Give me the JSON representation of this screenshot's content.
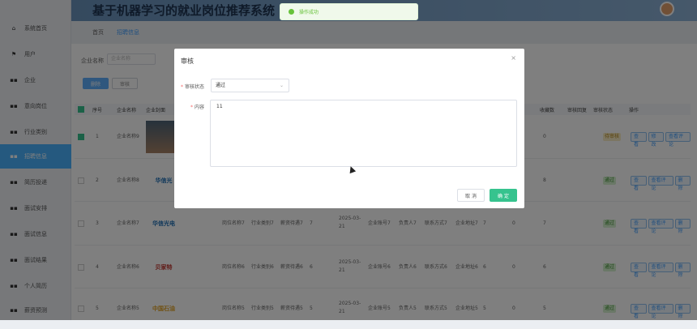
{
  "header": {
    "title": "基于机器学习的就业岗位推荐系统"
  },
  "sidebar": {
    "items": [
      {
        "label": "系统首页",
        "icon": "home-icon"
      },
      {
        "label": "用户",
        "icon": "flag-icon"
      },
      {
        "label": "企业",
        "icon": "grid-icon"
      },
      {
        "label": "意向岗位",
        "icon": "grid-icon"
      },
      {
        "label": "行业类别",
        "icon": "grid-icon"
      },
      {
        "label": "招聘信息",
        "icon": "grid-icon",
        "active": true
      },
      {
        "label": "简历投递",
        "icon": "grid-icon"
      },
      {
        "label": "面试安排",
        "icon": "grid-icon"
      },
      {
        "label": "面试信息",
        "icon": "grid-icon"
      },
      {
        "label": "面试结果",
        "icon": "grid-icon"
      },
      {
        "label": "个人简历",
        "icon": "grid-icon"
      },
      {
        "label": "薪资预测",
        "icon": "grid-icon"
      }
    ]
  },
  "breadcrumb": [
    "首页",
    "招聘信息"
  ],
  "search": {
    "label": "企业名称",
    "placeholder": "企业名称"
  },
  "toolbar": {
    "delete_label": "删除",
    "audit_label": "审核"
  },
  "table": {
    "headers": [
      "序号",
      "企业名称",
      "企业封面",
      "收藏数",
      "审核回复",
      "审核状态",
      "操作"
    ],
    "rows": [
      {
        "index": "1",
        "company": "企业名称9",
        "logo": "",
        "fav": "0",
        "status": "待审核",
        "checked": true,
        "ops": [
          "查看",
          "修改",
          "查看评论"
        ],
        "extra": []
      },
      {
        "index": "2",
        "company": "企业名称8",
        "logo": "华信光",
        "fav": "8",
        "status": "通过",
        "ops": [
          "查看",
          "查看评论",
          "删除"
        ],
        "extra": []
      },
      {
        "index": "3",
        "company": "企业名称7",
        "logo": "华信光电",
        "fav": "7",
        "status": "通过",
        "ops": [
          "查看",
          "查看评论",
          "删除"
        ],
        "extra": [
          "岗位名称7",
          "行业类别7",
          "薪资待遇7",
          "7",
          "2025-03-21",
          "企业账号7",
          "负责人7",
          "联系方式7",
          "企业地址7",
          "7",
          "0"
        ]
      },
      {
        "index": "4",
        "company": "企业名称6",
        "logo": "贝家特",
        "fav": "6",
        "status": "通过",
        "ops": [
          "查看",
          "查看评论",
          "删除"
        ],
        "extra": [
          "岗位名称6",
          "行业类别6",
          "薪资待遇6",
          "6",
          "2025-03-21",
          "企业账号6",
          "负责人6",
          "联系方式6",
          "企业地址6",
          "6",
          "0"
        ]
      },
      {
        "index": "5",
        "company": "企业名称5",
        "logo": "中国石油",
        "fav": "5",
        "status": "通过",
        "ops": [
          "查看",
          "查看评论",
          "删除"
        ],
        "extra": [
          "岗位名称5",
          "行业类别5",
          "薪资待遇5",
          "5",
          "2025-03-21",
          "企业账号5",
          "负责人5",
          "联系方式5",
          "企业地址5",
          "5",
          "0"
        ]
      }
    ]
  },
  "toast": {
    "message": "操作成功"
  },
  "dialog": {
    "title": "审核",
    "close_icon": "close-icon",
    "status_label": "审核状态",
    "status_value": "通过",
    "content_label": "内容",
    "content_value": "11",
    "cancel_label": "取 消",
    "ok_label": "确 定"
  },
  "colors": {
    "accent": "#409eff",
    "success": "#36c38e",
    "sidebar_active": "#4bb3ff"
  }
}
